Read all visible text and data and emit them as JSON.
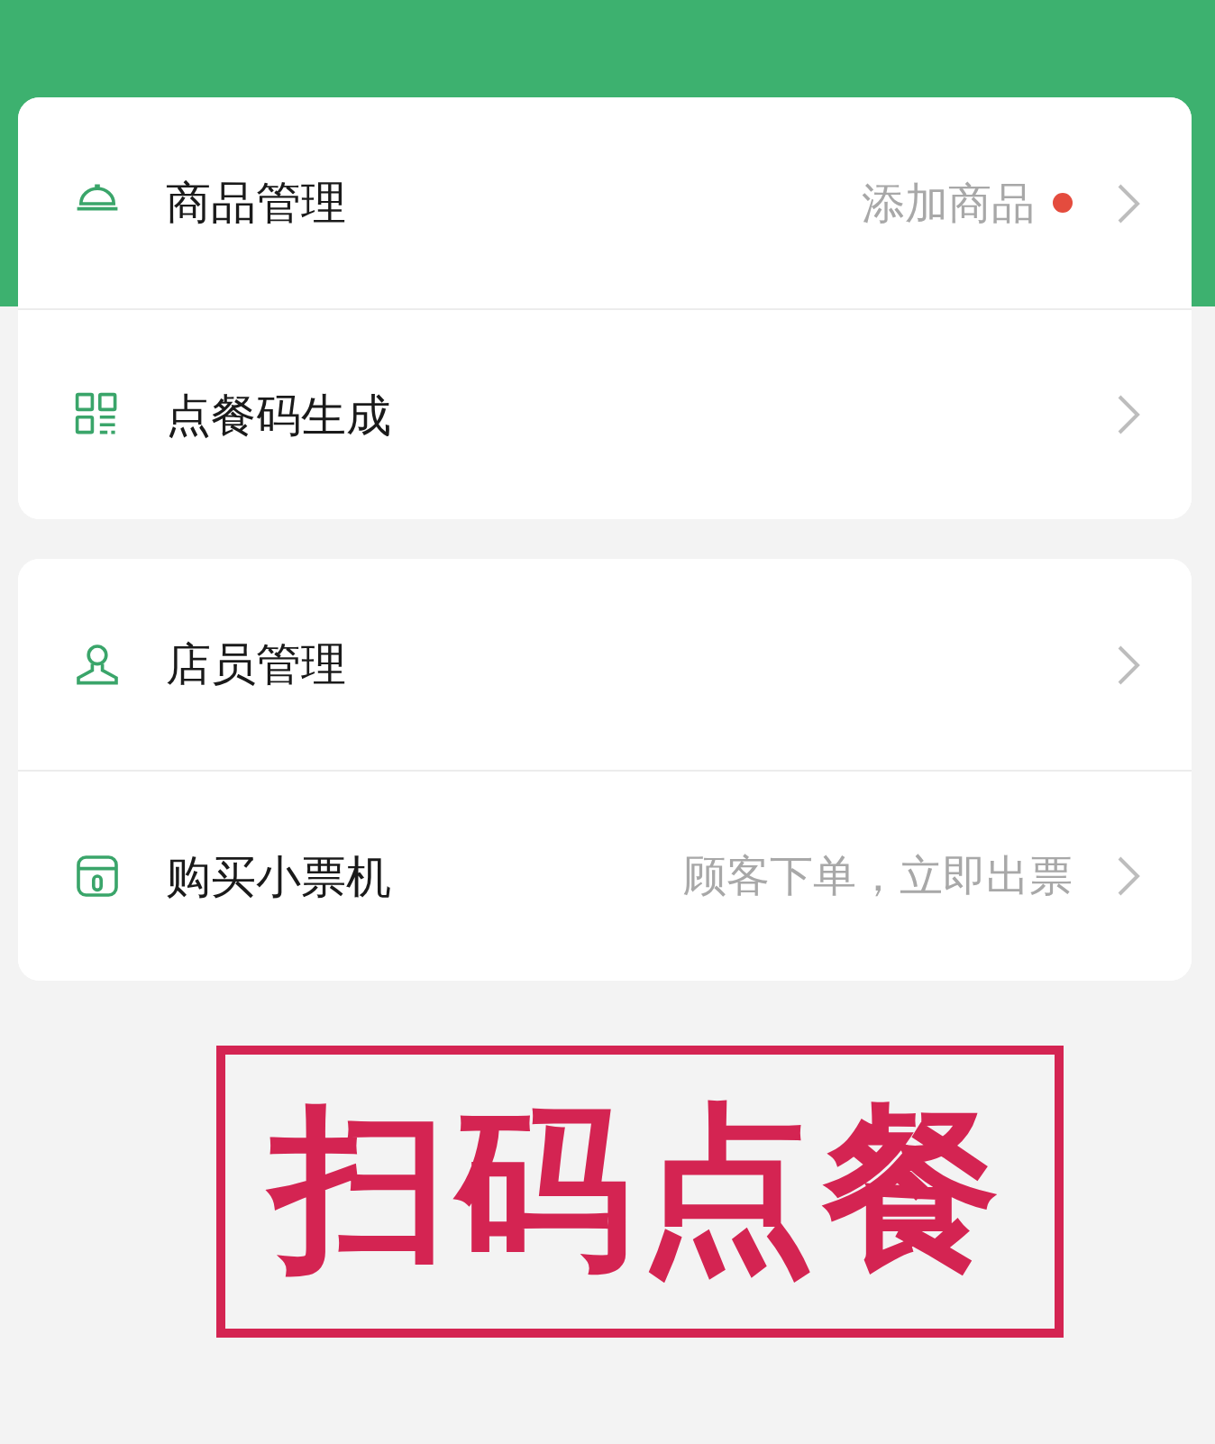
{
  "groups": [
    {
      "items": [
        {
          "label": "商品管理",
          "hint": "添加商品",
          "badge": true
        },
        {
          "label": "点餐码生成",
          "badge": false
        }
      ]
    },
    {
      "items": [
        {
          "label": "店员管理",
          "badge": false
        },
        {
          "label": "购买小票机",
          "hint": "顾客下单，立即出票",
          "badge": false
        }
      ]
    }
  ],
  "caption": "扫码点餐"
}
